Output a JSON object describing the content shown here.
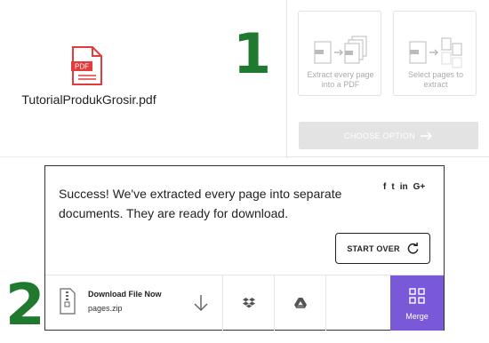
{
  "step1": {
    "number": "1",
    "file_icon_label": "PDF",
    "file_name": "TutorialProdukGrosir.pdf",
    "options": [
      {
        "label": "Extract every page into a PDF"
      },
      {
        "label": "Select pages to extract"
      }
    ],
    "choose_button": "CHOOSE OPTION",
    "accent_color": "#e33b3b"
  },
  "step2": {
    "number": "2",
    "success_message": "Success! We've extracted every page into separate documents. They are ready for download.",
    "social": [
      "f",
      "t",
      "in",
      "G+"
    ],
    "start_over_label": "START OVER",
    "download": {
      "title": "Download File Now",
      "file": "pages.zip"
    },
    "merge_label": "Merge",
    "merge_color": "#7a59d9"
  }
}
